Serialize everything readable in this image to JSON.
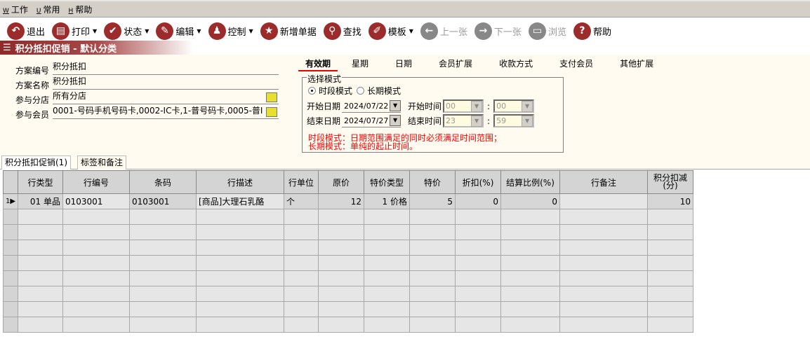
{
  "menu": [
    {
      "key": "W",
      "label": "工作"
    },
    {
      "key": "U",
      "label": "常用"
    },
    {
      "key": "H",
      "label": "帮助"
    }
  ],
  "toolbar": [
    {
      "label": "退出",
      "icon": "undo-icon",
      "glyph": "↶",
      "dd": false,
      "disabled": false
    },
    {
      "label": "打印",
      "icon": "printer-icon",
      "glyph": "▤",
      "dd": true,
      "disabled": false
    },
    {
      "label": "状态",
      "icon": "check-icon",
      "glyph": "✔",
      "dd": true,
      "disabled": false
    },
    {
      "label": "编辑",
      "icon": "pencil-icon",
      "glyph": "✎",
      "dd": true,
      "disabled": false
    },
    {
      "label": "控制",
      "icon": "user-icon",
      "glyph": "♟",
      "dd": true,
      "disabled": false
    },
    {
      "label": "新增单据",
      "icon": "star-icon",
      "glyph": "★",
      "dd": false,
      "disabled": false
    },
    {
      "label": "查找",
      "icon": "search-icon",
      "glyph": "⚲",
      "dd": false,
      "disabled": false
    },
    {
      "label": "模板",
      "icon": "eraser-icon",
      "glyph": "✐",
      "dd": true,
      "disabled": false
    },
    {
      "label": "上一张",
      "icon": "arrow-left-icon",
      "glyph": "←",
      "dd": false,
      "disabled": true
    },
    {
      "label": "下一张",
      "icon": "arrow-right-icon",
      "glyph": "→",
      "dd": false,
      "disabled": true
    },
    {
      "label": "浏览",
      "icon": "folder-icon",
      "glyph": "▭",
      "dd": false,
      "disabled": true
    },
    {
      "label": "帮助",
      "icon": "help-icon",
      "glyph": "?",
      "dd": false,
      "disabled": false
    }
  ],
  "title": "积分抵扣促销 - 默认分类",
  "form": {
    "fields": [
      {
        "label": "方案编号",
        "value": "积分抵扣"
      },
      {
        "label": "方案名称",
        "value": "积分抵扣"
      },
      {
        "label": "参与分店",
        "value": "所有分店"
      },
      {
        "label": "参与会员",
        "value": "0001-号码手机号码卡,0002-IC卡,1-普号码卡,0005-普I"
      }
    ]
  },
  "tabs": [
    "有效期",
    "星期",
    "日期",
    "会员扩展",
    "收款方式",
    "支付会员",
    "其他扩展"
  ],
  "validity": {
    "group_label": "选择模式",
    "mode1": "时段模式",
    "mode2": "长期模式",
    "start_date_label": "开始日期",
    "start_date": "2024/07/22",
    "end_date_label": "结束日期",
    "end_date": "2024/07/27",
    "start_time_label": "开始时间",
    "start_h": "00",
    "start_m": "00",
    "end_time_label": "结束时间",
    "end_h": "23",
    "end_m": "59",
    "colon": ":",
    "note1": "时段模式：日期范围满足的同时必须满足时间范围；",
    "note2": "长期模式：单纯的起止时间。"
  },
  "subtabs": [
    "积分抵扣促销(1)",
    "标签和备注"
  ],
  "grid": {
    "columns": [
      "行类型",
      "行编号",
      "条码",
      "行描述",
      "行单位",
      "原价",
      "特价类型",
      "特价",
      "折扣(%)",
      "结算比例(%)",
      "行备注",
      "积分扣减(分)"
    ],
    "rows": [
      [
        "01 单品",
        "0103001",
        "0103001",
        "[商品]大理石乳酪",
        "个",
        "12",
        "1 价格",
        "5",
        "0",
        "0",
        "",
        "10"
      ]
    ],
    "row_marker": "1▶"
  }
}
